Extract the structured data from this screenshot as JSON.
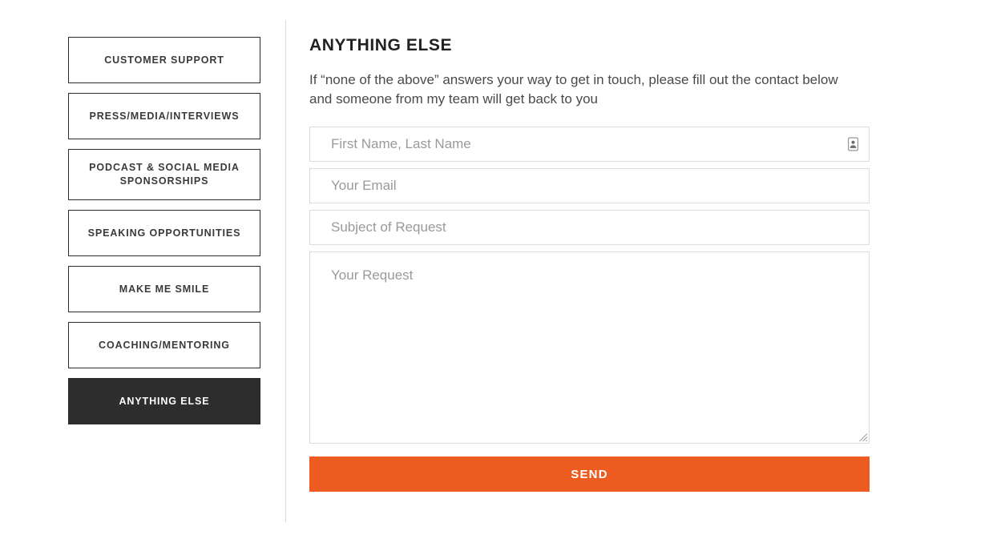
{
  "sidebar": {
    "name": "contact-category-nav",
    "items": [
      {
        "label": "CUSTOMER SUPPORT",
        "lines": 1,
        "active": false
      },
      {
        "label": "PRESS/MEDIA/INTERVIEWS",
        "lines": 1,
        "active": false
      },
      {
        "label": "PODCAST & SOCIAL MEDIA SPONSORSHIPS",
        "lines": 2,
        "active": false
      },
      {
        "label": "SPEAKING OPPORTUNITIES",
        "lines": 1,
        "active": false
      },
      {
        "label": "MAKE ME SMILE",
        "lines": 1,
        "active": false
      },
      {
        "label": "COACHING/MENTORING",
        "lines": 1,
        "active": false
      },
      {
        "label": "ANYTHING ELSE",
        "lines": 1,
        "active": true
      }
    ]
  },
  "panel": {
    "title": "ANYTHING ELSE",
    "description": "If “none of the above” answers your way to get in touch, please fill out the contact below and someone from my team will get back to you"
  },
  "form": {
    "name_field": {
      "placeholder": "First Name, Last Name",
      "value": "",
      "icon": "contact-card-autofill-icon"
    },
    "email_field": {
      "placeholder": "Your Email",
      "value": ""
    },
    "subject_field": {
      "placeholder": "Subject of Request",
      "value": ""
    },
    "request_field": {
      "placeholder": "Your Request",
      "value": "",
      "resize_handle": "resize-grip-icon"
    },
    "submit": {
      "label": "SEND"
    }
  },
  "colors": {
    "accent_orange": "#ec5c20",
    "active_dark": "#2d2d2d",
    "button_border": "#2b2b2b",
    "field_border": "#dcdcdc",
    "placeholder": "#9a9a9a",
    "divider": "#d9d9d9",
    "page_background": "#ffffff"
  }
}
